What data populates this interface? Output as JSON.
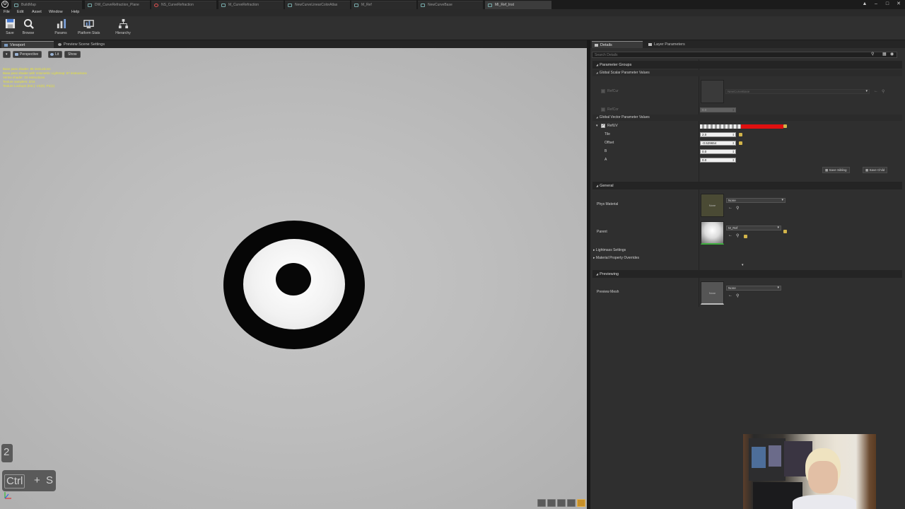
{
  "tabs": [
    {
      "label": "BuildMap",
      "active": false
    },
    {
      "label": "DW_CurveRefraction_Plane",
      "active": false
    },
    {
      "label": "NS_CurveRefraction",
      "active": false
    },
    {
      "label": "M_CurveRefraction",
      "active": false
    },
    {
      "label": "NewCurveLinearColorAtlas",
      "active": false
    },
    {
      "label": "M_Ref",
      "active": false
    },
    {
      "label": "NewCurveBase",
      "active": false
    },
    {
      "label": "MI_Ref_Inst",
      "active": true
    }
  ],
  "menu": [
    "File",
    "Edit",
    "Asset",
    "Window",
    "Help"
  ],
  "toolbar": [
    {
      "label": "Save",
      "icon": "save-icon"
    },
    {
      "label": "Browse",
      "icon": "browse-icon"
    },
    {
      "label": "Params",
      "icon": "params-icon"
    },
    {
      "label": "Platform Stats",
      "icon": "platform-stats-icon"
    },
    {
      "label": "Hierarchy",
      "icon": "hierarchy-icon"
    }
  ],
  "viewport": {
    "tab": "Viewport",
    "tab2": "Preview Scene Settings",
    "perspective": "Perspective",
    "lit": "Lit",
    "show": "Show",
    "stats": [
      "Base pass shader: 86 instructions",
      "Base pass shader with Volumetric Lightmap: 97 instructions",
      "Vertex shader: 33 instructions",
      "Texture samplers: 2/16",
      "Texture Lookups (Est.): VS(0), PS(1)"
    ],
    "key_number": "2",
    "key_ctrl": "Ctrl",
    "key_plus": "+",
    "key_s": "S"
  },
  "details": {
    "tab": "Details",
    "tab2": "Layer Parameters",
    "search_placeholder": "Search Details",
    "parameter_groups": "Parameter Groups",
    "global_scalar": "Global Scalar Parameter Values",
    "refcur_label": "RefCur",
    "refcur_curve": "NewCurveBase",
    "refcor_label": "RefCor",
    "refcor_value": "0.0",
    "global_vector": "Global Vector Parameter Values",
    "refuv_label": "RefUV",
    "tile_label": "Tile",
    "tile_value": "2.0",
    "offset_label": "Offset",
    "offset_value": "-0.529654",
    "b_label": "B",
    "b_value": "0.0",
    "a_label": "A",
    "a_value": "0.0",
    "save_sibling": "Save Sibling",
    "save_child": "Save Child",
    "general": "General",
    "phys_material_label": "Phys Material",
    "phys_material_value": "None",
    "phys_thumb": "None",
    "parent_label": "Parent",
    "parent_value": "M_Ref",
    "lightmass": "Lightmass Settings",
    "mpo": "Material Property Overrides",
    "previewing": "Previewing",
    "preview_mesh_label": "Preview Mesh",
    "preview_mesh_value": "None",
    "preview_thumb": "None"
  },
  "colors": {
    "refuv_color": "#e01010",
    "stats_text": "#e6e23a",
    "panel_bg": "#2f2f2f"
  }
}
